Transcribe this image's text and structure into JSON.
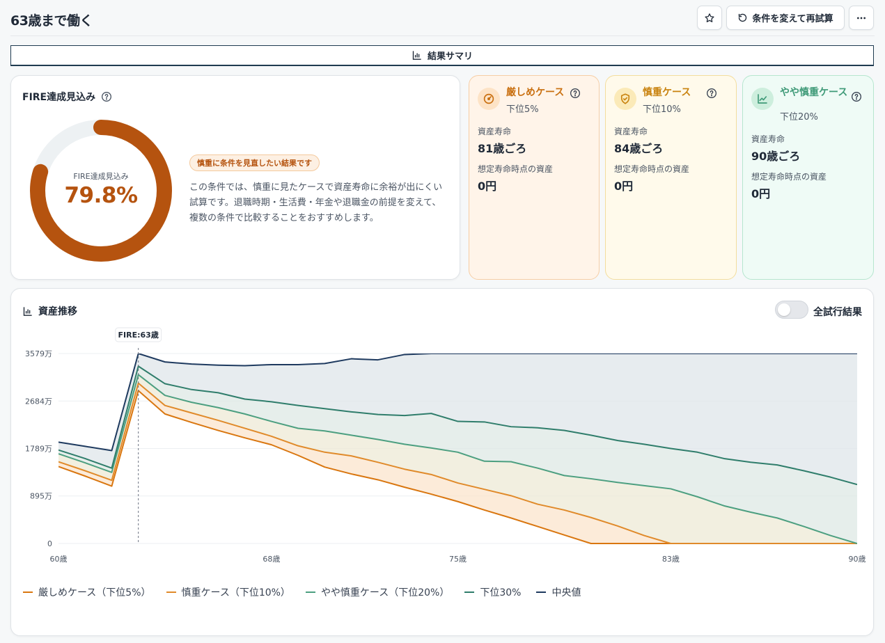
{
  "header": {
    "title": "63歳まで働く",
    "retry_label": "条件を変えて再試算"
  },
  "summary_bar": {
    "label": "結果サマリ"
  },
  "fire": {
    "title": "FIRE達成見込み",
    "donut_label": "FIRE達成見込み",
    "value_text": "79.8%",
    "value": 0.798,
    "badge": "慎重に条件を見直したい結果です",
    "description": "この条件では、慎重に見たケースで資産寿命に余裕が出にくい試算です。退職時期・生活費・年金や退職金の前提を変えて、複数の条件で比較することをおすすめします。"
  },
  "cases": [
    {
      "name": "厳しめケース",
      "sub": "下位5%",
      "life_label": "資産寿命",
      "life_value": "81歳ごろ",
      "asset_label": "想定寿命時点の資産",
      "asset_value": "0円",
      "icon": "gauge-icon"
    },
    {
      "name": "慎重ケース",
      "sub": "下位10%",
      "life_label": "資産寿命",
      "life_value": "84歳ごろ",
      "asset_label": "想定寿命時点の資産",
      "asset_value": "0円",
      "icon": "shield-icon"
    },
    {
      "name": "やや慎重ケース",
      "sub": "下位20%",
      "life_label": "資産寿命",
      "life_value": "90歳ごろ",
      "asset_label": "想定寿命時点の資産",
      "asset_value": "0円",
      "icon": "trend-chart-icon"
    }
  ],
  "chart_section": {
    "title": "資産推移",
    "toggle_label": "全試行結果",
    "toggle_on": false
  },
  "chart_data": {
    "type": "line",
    "marker_label": "FIRE:63歳",
    "marker_x": 63,
    "xlim": [
      60,
      90
    ],
    "ylim": [
      0,
      3579
    ],
    "x_ticks": [
      60,
      68,
      75,
      83,
      90
    ],
    "x_tick_labels": [
      "60歳",
      "68歳",
      "75歳",
      "83歳",
      "90歳"
    ],
    "y_ticks": [
      0,
      895,
      1789,
      2684,
      3579
    ],
    "y_tick_labels": [
      "0",
      "895万",
      "1789万",
      "2684万",
      "3579万"
    ],
    "x": [
      60,
      61,
      62,
      63,
      64,
      65,
      66,
      67,
      68,
      69,
      70,
      71,
      72,
      73,
      74,
      75,
      76,
      77,
      78,
      79,
      80,
      81,
      82,
      83,
      84,
      85,
      86,
      87,
      88,
      89,
      90
    ],
    "series": [
      {
        "name": "厳しめケース（下位5%）",
        "color": "#d9760f",
        "values": [
          1450,
          1270,
          1080,
          2880,
          2440,
          2280,
          2130,
          1990,
          1860,
          1660,
          1440,
          1310,
          1200,
          1060,
          930,
          790,
          630,
          480,
          320,
          160,
          0,
          0,
          0,
          0,
          0,
          0,
          0,
          0,
          0,
          0,
          0
        ]
      },
      {
        "name": "慎重ケース（下位10%）",
        "color": "#e08a2a",
        "values": [
          1540,
          1370,
          1190,
          3020,
          2600,
          2460,
          2320,
          2170,
          2020,
          1840,
          1720,
          1650,
          1530,
          1400,
          1300,
          1140,
          1020,
          900,
          740,
          630,
          490,
          330,
          150,
          0,
          0,
          0,
          0,
          0,
          0,
          0,
          0
        ]
      },
      {
        "name": "やや慎重ケース（下位20%）",
        "color": "#4c9f80",
        "values": [
          1690,
          1520,
          1340,
          3180,
          2790,
          2660,
          2560,
          2440,
          2300,
          2170,
          2120,
          2040,
          1960,
          1870,
          1800,
          1720,
          1550,
          1540,
          1420,
          1280,
          1220,
          1150,
          1090,
          1030,
          880,
          710,
          590,
          480,
          320,
          150,
          0
        ]
      },
      {
        "name": "下位30%",
        "color": "#2f7d6b",
        "values": [
          1760,
          1600,
          1420,
          3340,
          3010,
          2900,
          2840,
          2720,
          2670,
          2600,
          2540,
          2480,
          2430,
          2410,
          2450,
          2300,
          2290,
          2200,
          2180,
          2130,
          2040,
          1940,
          1870,
          1790,
          1720,
          1600,
          1530,
          1480,
          1370,
          1250,
          1110
        ]
      },
      {
        "name": "中央値",
        "color": "#1e3a5f",
        "values": [
          1910,
          1830,
          1750,
          3720,
          3420,
          3380,
          3360,
          3350,
          3370,
          3370,
          3390,
          3480,
          3460,
          3560,
          3620,
          3650,
          3680,
          3700,
          3720,
          3740,
          3760,
          3780,
          3800,
          3810,
          3820,
          3830,
          3840,
          3850,
          3860,
          3870,
          3880
        ]
      }
    ],
    "legend_position": "bottom-left",
    "grid": true
  }
}
